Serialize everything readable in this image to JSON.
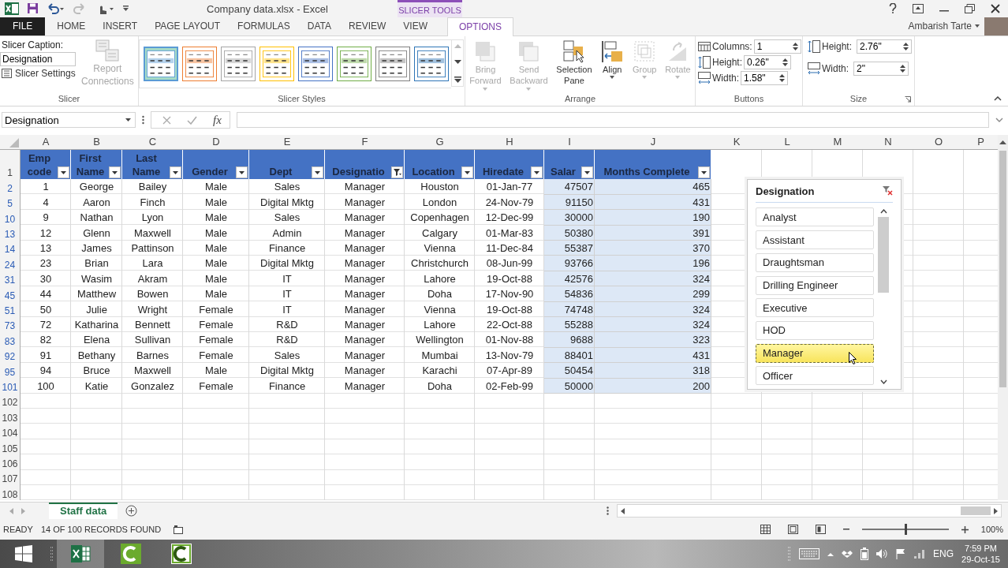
{
  "title_bar": {
    "title": "Company data.xlsx - Excel",
    "context_label": "SLICER TOOLS"
  },
  "tabs": [
    {
      "label": "FILE",
      "kind": "file",
      "selected": false
    },
    {
      "label": "HOME",
      "kind": "normal",
      "selected": false
    },
    {
      "label": "INSERT",
      "kind": "normal",
      "selected": false
    },
    {
      "label": "PAGE LAYOUT",
      "kind": "normal",
      "selected": false
    },
    {
      "label": "FORMULAS",
      "kind": "normal",
      "selected": false
    },
    {
      "label": "DATA",
      "kind": "normal",
      "selected": false
    },
    {
      "label": "REVIEW",
      "kind": "normal",
      "selected": false
    },
    {
      "label": "VIEW",
      "kind": "normal",
      "selected": false
    },
    {
      "label": "OPTIONS",
      "kind": "normal",
      "selected": true
    }
  ],
  "account": {
    "user": "Ambarish Tarte"
  },
  "ribbon": {
    "slicer_group": {
      "label": "Slicer",
      "caption_label": "Slicer Caption:",
      "caption_value": "Designation",
      "settings": "Slicer Settings",
      "report_connections": {
        "label": "Report Connections",
        "disabled": true
      }
    },
    "styles_group": {
      "label": "Slicer Styles",
      "styles": [
        {
          "color": "#5b9bd5",
          "selected": true
        },
        {
          "color": "#ed7d31",
          "selected": false
        },
        {
          "color": "#a5a5a5",
          "selected": false
        },
        {
          "color": "#ffc000",
          "selected": false
        },
        {
          "color": "#4472c4",
          "selected": false
        },
        {
          "color": "#70ad47",
          "selected": false
        },
        {
          "color": "#7f7f7f",
          "selected": false
        },
        {
          "color": "#2e75b6",
          "selected": false
        }
      ]
    },
    "arrange_group": {
      "label": "Arrange",
      "buttons": [
        {
          "label": "Bring Forward",
          "kind": "bring_forward",
          "disabled": true,
          "dropdown": true
        },
        {
          "label": "Send Backward",
          "kind": "send_backward",
          "disabled": true,
          "dropdown": true
        },
        {
          "label": "Selection Pane",
          "kind": "selection_pane",
          "disabled": false,
          "dropdown": false
        },
        {
          "label": "Align",
          "kind": "align",
          "disabled": false,
          "dropdown": true
        },
        {
          "label": "Group",
          "kind": "group",
          "disabled": true,
          "dropdown": true
        },
        {
          "label": "Rotate",
          "kind": "rotate",
          "disabled": true,
          "dropdown": true
        }
      ]
    },
    "buttons_group": {
      "label": "Buttons",
      "fields": [
        {
          "label": "Columns:",
          "kind": "columns",
          "value": "1"
        },
        {
          "label": "Height:",
          "kind": "height",
          "value": "0.26\""
        },
        {
          "label": "Width:",
          "kind": "width",
          "value": "1.58\""
        }
      ]
    },
    "size_group": {
      "label": "Size",
      "fields": [
        {
          "label": "Height:",
          "kind": "height",
          "value": "2.76\""
        },
        {
          "label": "Width:",
          "kind": "width",
          "value": "2\""
        }
      ]
    }
  },
  "formula_bar": {
    "name_box": "Designation",
    "function_label": "fx"
  },
  "sheet": {
    "column_letters": [
      "A",
      "B",
      "C",
      "D",
      "E",
      "F",
      "G",
      "H",
      "I",
      "J",
      "K",
      "L",
      "M",
      "N",
      "O",
      "P"
    ],
    "header_row": "1",
    "headers": [
      {
        "label": "Emp code",
        "filtered": false
      },
      {
        "label": "First Name",
        "filtered": false
      },
      {
        "label": "Last Name",
        "filtered": false
      },
      {
        "label": "Gender",
        "filtered": false
      },
      {
        "label": "Dept",
        "filtered": false
      },
      {
        "label": "Designatio",
        "filtered": true
      },
      {
        "label": "Location",
        "filtered": false
      },
      {
        "label": "Hiredate",
        "filtered": false
      },
      {
        "label": "Salar",
        "filtered": false
      },
      {
        "label": "Months Complete",
        "filtered": false
      }
    ],
    "rows": [
      {
        "number": "2",
        "cells": [
          "1",
          "George",
          "Bailey",
          "Male",
          "Sales",
          "Manager",
          "Houston",
          "01-Jan-77",
          "47507",
          "465"
        ]
      },
      {
        "number": "5",
        "cells": [
          "4",
          "Aaron",
          "Finch",
          "Male",
          "Digital Mktg",
          "Manager",
          "London",
          "24-Nov-79",
          "91150",
          "431"
        ]
      },
      {
        "number": "10",
        "cells": [
          "9",
          "Nathan",
          "Lyon",
          "Male",
          "Sales",
          "Manager",
          "Copenhagen",
          "12-Dec-99",
          "30000",
          "190"
        ]
      },
      {
        "number": "13",
        "cells": [
          "12",
          "Glenn",
          "Maxwell",
          "Male",
          "Admin",
          "Manager",
          "Calgary",
          "01-Mar-83",
          "50380",
          "391"
        ]
      },
      {
        "number": "14",
        "cells": [
          "13",
          "James",
          "Pattinson",
          "Male",
          "Finance",
          "Manager",
          "Vienna",
          "11-Dec-84",
          "55387",
          "370"
        ]
      },
      {
        "number": "24",
        "cells": [
          "23",
          "Brian",
          "Lara",
          "Male",
          "Digital Mktg",
          "Manager",
          "Christchurch",
          "08-Jun-99",
          "93766",
          "196"
        ]
      },
      {
        "number": "31",
        "cells": [
          "30",
          "Wasim",
          "Akram",
          "Male",
          "IT",
          "Manager",
          "Lahore",
          "19-Oct-88",
          "42576",
          "324"
        ]
      },
      {
        "number": "45",
        "cells": [
          "44",
          "Matthew",
          "Bowen",
          "Male",
          "IT",
          "Manager",
          "Doha",
          "17-Nov-90",
          "54836",
          "299"
        ]
      },
      {
        "number": "51",
        "cells": [
          "50",
          "Julie",
          "Wright",
          "Female",
          "IT",
          "Manager",
          "Vienna",
          "19-Oct-88",
          "74748",
          "324"
        ]
      },
      {
        "number": "73",
        "cells": [
          "72",
          "Katharina",
          "Bennett",
          "Female",
          "R&D",
          "Manager",
          "Lahore",
          "22-Oct-88",
          "55288",
          "324"
        ]
      },
      {
        "number": "83",
        "cells": [
          "82",
          "Elena",
          "Sullivan",
          "Female",
          "R&D",
          "Manager",
          "Wellington",
          "01-Nov-88",
          "9688",
          "323"
        ]
      },
      {
        "number": "92",
        "cells": [
          "91",
          "Bethany",
          "Barnes",
          "Female",
          "Sales",
          "Manager",
          "Mumbai",
          "13-Nov-79",
          "88401",
          "431"
        ]
      },
      {
        "number": "95",
        "cells": [
          "94",
          "Bruce",
          "Maxwell",
          "Male",
          "Digital Mktg",
          "Manager",
          "Karachi",
          "07-Apr-89",
          "50454",
          "318"
        ]
      },
      {
        "number": "101",
        "cells": [
          "100",
          "Katie",
          "Gonzalez",
          "Female",
          "Finance",
          "Manager",
          "Doha",
          "02-Feb-99",
          "50000",
          "200"
        ]
      }
    ],
    "empty_rows": [
      "102",
      "103",
      "104",
      "105",
      "106",
      "107",
      "108"
    ]
  },
  "slicer": {
    "title": "Designation",
    "items": [
      {
        "label": "Analyst",
        "selected": false
      },
      {
        "label": "Assistant",
        "selected": false
      },
      {
        "label": "Draughtsman",
        "selected": false
      },
      {
        "label": "Drilling Engineer",
        "selected": false
      },
      {
        "label": "Executive",
        "selected": false
      },
      {
        "label": "HOD",
        "selected": false
      },
      {
        "label": "Manager",
        "selected": true
      },
      {
        "label": "Officer",
        "selected": false
      }
    ]
  },
  "sheet_tabs": [
    {
      "label": "Staff data",
      "selected": true
    }
  ],
  "status_bar": {
    "mode": "READY",
    "records": "14 OF 100 RECORDS FOUND",
    "zoom": {
      "level": 0.5,
      "reading": "100%"
    }
  },
  "taskbar": {
    "language": "ENG",
    "time": "7:59 PM",
    "date": "29-Oct-15"
  }
}
